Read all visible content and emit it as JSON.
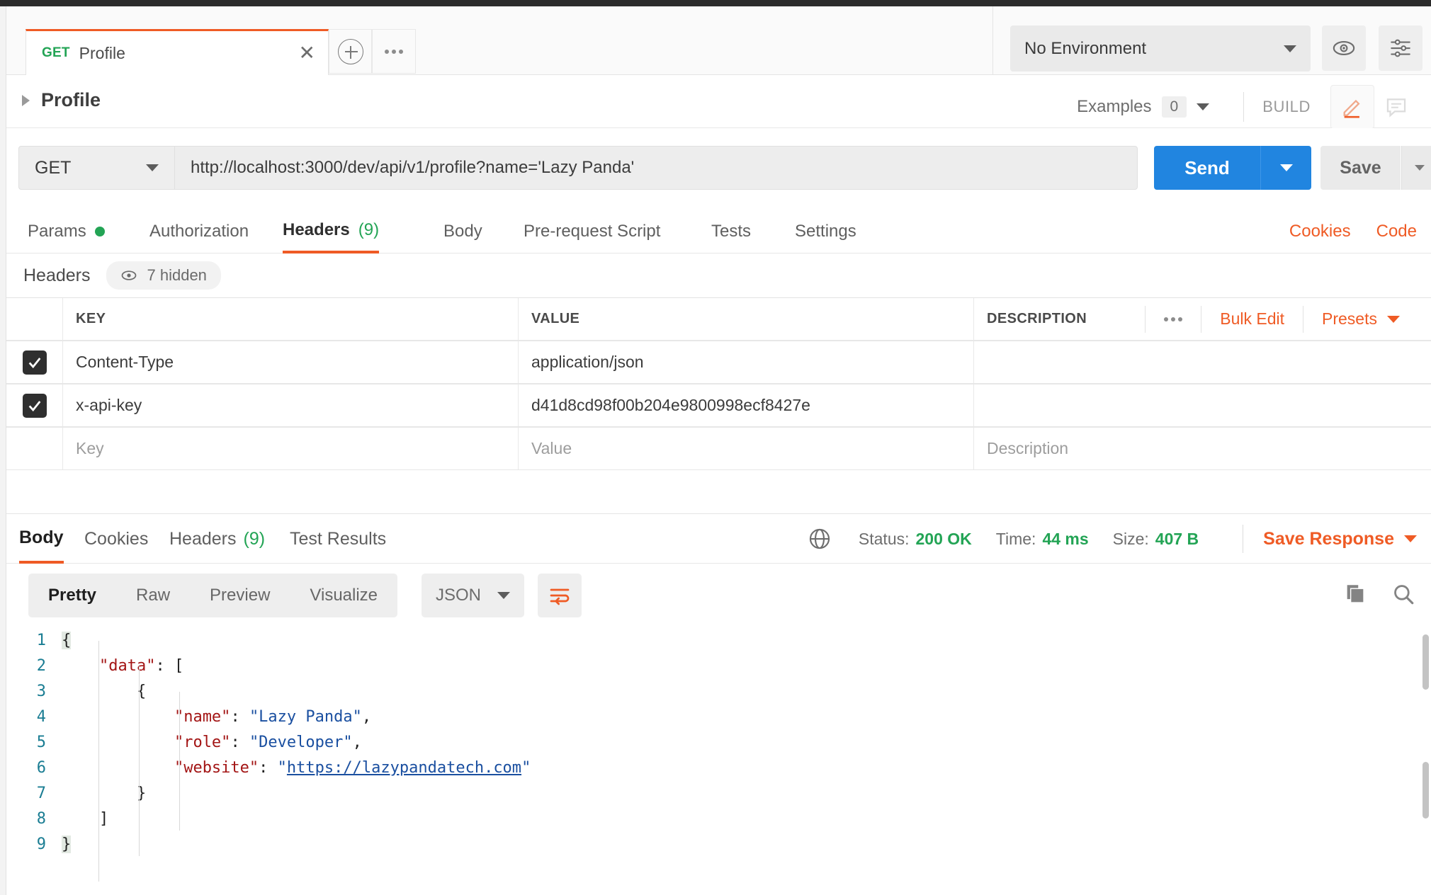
{
  "tab": {
    "method": "GET",
    "name": "Profile",
    "close_icon": "close-icon",
    "new_tab_icon": "plus-circle-icon",
    "more_icon": "ellipsis-icon"
  },
  "environment": {
    "selected": "No Environment",
    "eye_icon": "eye-icon",
    "settings_icon": "sliders-icon"
  },
  "breadcrumb": {
    "name": "Profile",
    "examples_label": "Examples",
    "examples_count": "0",
    "build_label": "BUILD",
    "edit_icon": "pencil-icon",
    "comment_icon": "comment-icon"
  },
  "request": {
    "method": "GET",
    "url": "http://localhost:3000/dev/api/v1/profile?name='Lazy Panda'",
    "send_label": "Send",
    "save_label": "Save"
  },
  "request_tabs": [
    {
      "label": "Params",
      "dot": true,
      "selected": false
    },
    {
      "label": "Authorization",
      "selected": false
    },
    {
      "label": "Headers",
      "count": "(9)",
      "selected": true
    },
    {
      "label": "Body",
      "selected": false
    },
    {
      "label": "Pre-request Script",
      "selected": false
    },
    {
      "label": "Tests",
      "selected": false
    },
    {
      "label": "Settings",
      "selected": false
    }
  ],
  "request_tabs_right": [
    {
      "label": "Cookies"
    },
    {
      "label": "Code"
    }
  ],
  "headers_section": {
    "title": "Headers",
    "hidden_label": "7 hidden",
    "hidden_icon": "eye-icon",
    "columns": [
      "KEY",
      "VALUE",
      "DESCRIPTION"
    ],
    "actions": {
      "more_icon": "ellipsis-icon",
      "bulk_edit": "Bulk Edit",
      "presets": "Presets"
    },
    "rows": [
      {
        "checked": true,
        "key": "Content-Type",
        "value": "application/json",
        "description": ""
      },
      {
        "checked": true,
        "key": "x-api-key",
        "value": "d41d8cd98f00b204e9800998ecf8427e",
        "description": ""
      }
    ],
    "new_row_placeholders": {
      "key": "Key",
      "value": "Value",
      "description": "Description"
    }
  },
  "response_tabs": [
    {
      "label": "Body",
      "selected": true
    },
    {
      "label": "Cookies",
      "selected": false
    },
    {
      "label": "Headers",
      "count": "(9)",
      "selected": false
    },
    {
      "label": "Test Results",
      "selected": false
    }
  ],
  "response_meta": {
    "globe_icon": "globe-icon",
    "status_label": "Status:",
    "status_value": "200 OK",
    "time_label": "Time:",
    "time_value": "44 ms",
    "size_label": "Size:",
    "size_value": "407 B",
    "save_response": "Save Response"
  },
  "body_toolbar": {
    "views": [
      {
        "label": "Pretty",
        "selected": true
      },
      {
        "label": "Raw",
        "selected": false
      },
      {
        "label": "Preview",
        "selected": false
      },
      {
        "label": "Visualize",
        "selected": false
      }
    ],
    "format": "JSON",
    "wrap_icon": "word-wrap-icon",
    "copy_icon": "copy-icon",
    "search_icon": "search-icon"
  },
  "response_body": {
    "language": "json",
    "lines": [
      {
        "n": "1",
        "tokens": [
          {
            "t": "{",
            "c": "pun hl"
          }
        ]
      },
      {
        "n": "2",
        "tokens": [
          {
            "t": "    ",
            "c": "pun"
          },
          {
            "t": "\"data\"",
            "c": "key"
          },
          {
            "t": ": [",
            "c": "pun"
          }
        ]
      },
      {
        "n": "3",
        "tokens": [
          {
            "t": "        {",
            "c": "pun"
          }
        ]
      },
      {
        "n": "4",
        "tokens": [
          {
            "t": "            ",
            "c": "pun"
          },
          {
            "t": "\"name\"",
            "c": "key"
          },
          {
            "t": ": ",
            "c": "pun"
          },
          {
            "t": "\"Lazy Panda\"",
            "c": "str"
          },
          {
            "t": ",",
            "c": "pun"
          }
        ]
      },
      {
        "n": "5",
        "tokens": [
          {
            "t": "            ",
            "c": "pun"
          },
          {
            "t": "\"role\"",
            "c": "key"
          },
          {
            "t": ": ",
            "c": "pun"
          },
          {
            "t": "\"Developer\"",
            "c": "str"
          },
          {
            "t": ",",
            "c": "pun"
          }
        ]
      },
      {
        "n": "6",
        "tokens": [
          {
            "t": "            ",
            "c": "pun"
          },
          {
            "t": "\"website\"",
            "c": "key"
          },
          {
            "t": ": ",
            "c": "pun"
          },
          {
            "t": "\"",
            "c": "str"
          },
          {
            "t": "https://lazypandatech.com",
            "c": "link"
          },
          {
            "t": "\"",
            "c": "str"
          }
        ]
      },
      {
        "n": "7",
        "tokens": [
          {
            "t": "        }",
            "c": "pun"
          }
        ]
      },
      {
        "n": "8",
        "tokens": [
          {
            "t": "    ]",
            "c": "pun"
          }
        ]
      },
      {
        "n": "9",
        "tokens": [
          {
            "t": "}",
            "c": "pun hl"
          }
        ]
      }
    ]
  },
  "colors": {
    "accent": "#ef5b25",
    "send": "#2185e0",
    "success": "#23a455",
    "json_key": "#a31515",
    "json_string": "#1a4fa0",
    "line_number": "#1a7d93"
  }
}
